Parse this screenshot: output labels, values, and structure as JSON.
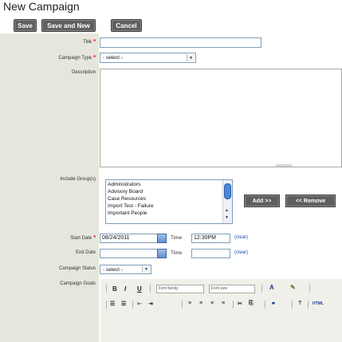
{
  "page": {
    "title": "New Campaign"
  },
  "toolbar": {
    "save": "Save",
    "save_new": "Save and New",
    "cancel": "Cancel"
  },
  "form": {
    "title_label": "Title",
    "campaign_type_label": "Campaign Type",
    "campaign_type_value": "- select -",
    "description_label": "Description",
    "include_groups_label": "Include Group(s)",
    "groups": [
      "Administrators",
      "Advisory Board",
      "Case Resources",
      "Import Test - Failure",
      "Important People"
    ],
    "add_button": "Add >>",
    "remove_button": "<< Remove",
    "start_date_label": "Start Date",
    "start_date_value": "08/24/2011",
    "start_time_label": "Time",
    "start_time_value": "12:30PM",
    "clear_label": "(clear)",
    "end_date_label": "End Date",
    "end_time_label": "Time",
    "campaign_status_label": "Campaign Status",
    "campaign_status_value": "- select -",
    "campaign_goals_label": "Campaign Goals",
    "required_marker": "*"
  },
  "editor": {
    "bold": "B",
    "italic": "I",
    "underline": "U",
    "font_family": "Font family",
    "font_size": "Font size"
  },
  "colors": {
    "label_bg": "#e6e6dc",
    "button_bg": "#5f5f5f",
    "link": "#1f4fa8",
    "required": "#cc0000"
  }
}
